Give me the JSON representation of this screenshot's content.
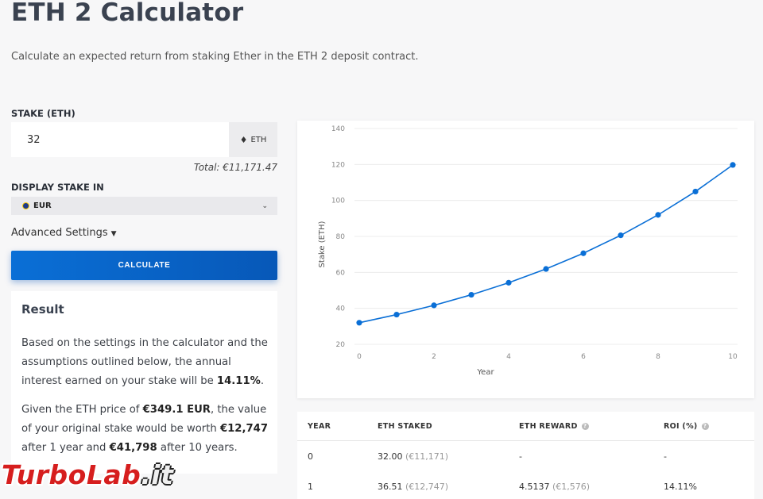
{
  "header": {
    "title": "ETH 2 Calculator",
    "subtitle": "Calculate an expected return from staking Ether in the ETH 2 deposit contract."
  },
  "form": {
    "stake_label": "STAKE (ETH)",
    "stake_value": "32",
    "stake_unit": "ETH",
    "total": "Total: €11,171.47",
    "display_label": "DISPLAY STAKE IN",
    "currency": "EUR",
    "advanced": "Advanced Settings",
    "calculate": "CALCULATE"
  },
  "result": {
    "title": "Result",
    "p1_text": "Based on the settings in the calculator and the assumptions outlined below, the annual interest earned on your stake will be ",
    "p1_rate": "14.11%",
    "p1_end": ".",
    "p2_a": "Given the ETH price of ",
    "p2_price": "€349.1 EUR",
    "p2_b": ", the value of your original stake would be worth ",
    "p2_v1": "€12,747",
    "p2_c": " after 1 year and ",
    "p2_v10": "€41,798",
    "p2_d": " after 10 years."
  },
  "chart_data": {
    "type": "line",
    "xlabel": "Year",
    "ylabel": "Stake (ETH)",
    "xlim": [
      0,
      10
    ],
    "ylim": [
      20,
      140
    ],
    "xticks": [
      0,
      2,
      4,
      6,
      8,
      10
    ],
    "yticks": [
      20,
      40,
      60,
      80,
      100,
      120,
      140
    ],
    "x": [
      0,
      1,
      2,
      3,
      4,
      5,
      6,
      7,
      8,
      9,
      10
    ],
    "values": [
      32.0,
      36.51,
      41.66,
      47.54,
      54.25,
      61.9,
      70.63,
      80.6,
      91.97,
      104.95,
      119.75
    ],
    "grid": true,
    "color": "#0a6fd6"
  },
  "table": {
    "headers": [
      "YEAR",
      "ETH STAKED",
      "ETH REWARD",
      "ROI (%)"
    ],
    "rows": [
      {
        "year": "0",
        "staked": "32.00",
        "staked_fiat": "(€11,171)",
        "reward": "-",
        "reward_fiat": "",
        "roi": "-"
      },
      {
        "year": "1",
        "staked": "36.51",
        "staked_fiat": "(€12,747)",
        "reward": "4.5137",
        "reward_fiat": "(€1,576)",
        "roi": "14.11%"
      }
    ]
  },
  "watermark": {
    "part1": "TurboLab",
    "part2": ".it"
  },
  "colors": {
    "accent": "#0a6fd6",
    "watermark": "#d61e1e"
  }
}
